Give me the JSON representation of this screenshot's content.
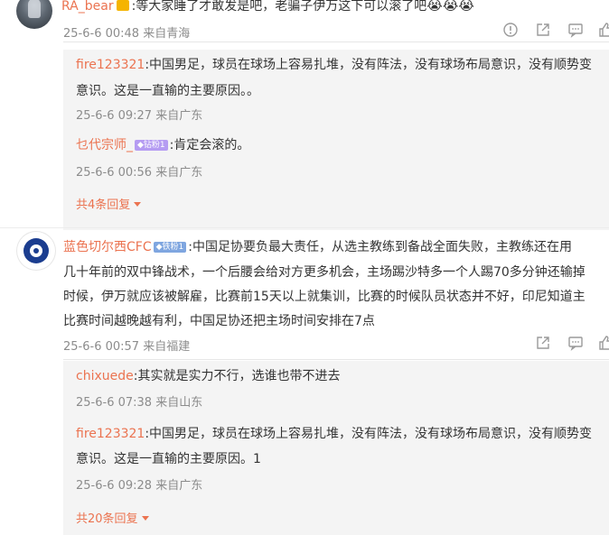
{
  "comments": [
    {
      "user": "RA_bear",
      "text": ":等大家睡了才敢发是吧，老骗子伊万这下可以滚了吧",
      "emojis": [
        "😭",
        "😭",
        "😭"
      ],
      "time": "25-6-6 00:48 来自青海",
      "icons": [
        "report-icon",
        "share-icon",
        "comment-icon",
        "like-icon"
      ]
    },
    {
      "user": "蓝色切尔西CFC",
      "badge": "铁粉1",
      "text_lines": [
        ":中国足协要负最大责任，从选主教练到备战全面失败，主教练还在用",
        "几十年前的双中锋战术，一个后腰会给对方更多机会，主场踢沙特多一个人踢70多分钟还输掉",
        "时候，伊万就应该被解雇，比赛前15天以上就集训，比赛的时候队员状态并不好，印尼知道主",
        "比赛时间越晚越有利，中国足协还把主场时间安排在7点"
      ],
      "time": "25-6-6 00:57 来自福建",
      "icons": [
        "share-icon",
        "comment-icon",
        "like-icon"
      ]
    }
  ],
  "replies_1": [
    {
      "user": "fire123321",
      "line1": ":中国男足，球员在球场上容易扎堆，没有阵法，没有球场布局意识，没有顺势变",
      "line2": "意识。这是一直输的主要原因。。",
      "time": "25-6-6 09:27 来自广东"
    },
    {
      "user": "乜代宗师_",
      "badge": "钻粉1",
      "line1": ":肯定会滚的。",
      "time": "25-6-6 00:56 来自广东"
    }
  ],
  "more_1": "共4条回复",
  "replies_2": [
    {
      "user": "chixuede",
      "line1": ":其实就是实力不行，选谁也带不进去",
      "time": "25-6-6 07:38 来自山东"
    },
    {
      "user": "fire123321",
      "line1": ":中国男足，球员在球场上容易扎堆，没有阵法，没有球场布局意识，没有顺势变",
      "line2": "意识。这是一直输的主要原因。1",
      "time": "25-6-6 09:28 来自广东"
    }
  ],
  "more_2": "共20条回复",
  "colors": {
    "name": "#eb7350",
    "meta": "#8c8c8c",
    "reply_bg": "#f4f4f4"
  }
}
